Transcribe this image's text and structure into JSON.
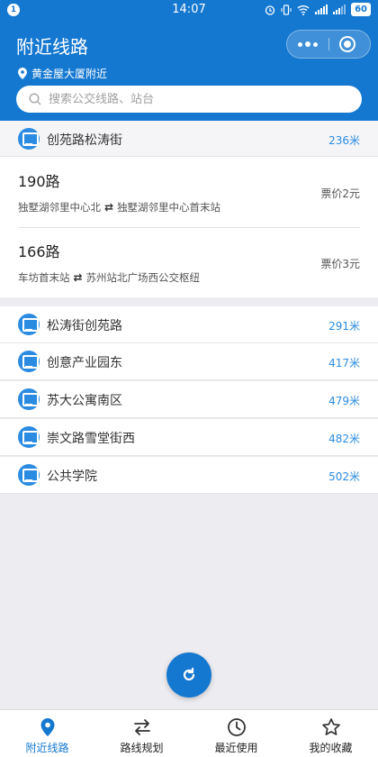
{
  "status_bar": {
    "notification_count": "1",
    "time": "14:07",
    "battery": "60"
  },
  "header": {
    "title": "附近线路",
    "location": "黄金屋大厦附近"
  },
  "search": {
    "placeholder": "搜索公交线路、站台"
  },
  "nearest_station": {
    "name": "创苑路松涛街",
    "distance": "236米"
  },
  "lines": [
    {
      "number": "190路",
      "from": "独墅湖邻里中心北",
      "to": "独墅湖邻里中心首末站",
      "price": "票价2元"
    },
    {
      "number": "166路",
      "from": "车坊首末站",
      "to": "苏州站北广场西公交枢纽",
      "price": "票价3元"
    }
  ],
  "stations": [
    {
      "name": "松涛街创苑路",
      "distance": "291米"
    },
    {
      "name": "创意产业园东",
      "distance": "417米"
    },
    {
      "name": "苏大公寓南区",
      "distance": "479米"
    },
    {
      "name": "崇文路雪堂街西",
      "distance": "482米"
    },
    {
      "name": "公共学院",
      "distance": "502米"
    }
  ],
  "tabbar": [
    {
      "label": "附近线路",
      "icon": "location-pin-icon",
      "active": true
    },
    {
      "label": "路线规划",
      "icon": "swap-arrows-icon",
      "active": false
    },
    {
      "label": "最近使用",
      "icon": "clock-icon",
      "active": false
    },
    {
      "label": "我的收藏",
      "icon": "star-icon",
      "active": false
    }
  ],
  "colors": {
    "primary": "#1578d0",
    "accent": "#2b8be0",
    "background": "#ececf1"
  }
}
